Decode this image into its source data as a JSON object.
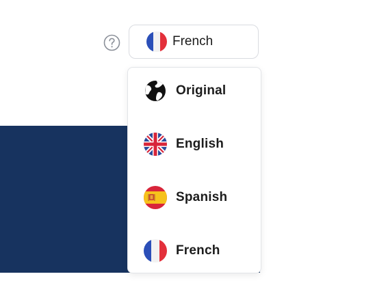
{
  "language_selector": {
    "selected_label": "French",
    "selected_flag": "france-flag-icon",
    "help_icon": "question-circle-icon"
  },
  "dropdown": {
    "options": [
      {
        "label": "Original",
        "icon": "globe-icon"
      },
      {
        "label": "English",
        "icon": "uk-flag-icon"
      },
      {
        "label": "Spanish",
        "icon": "spain-flag-icon"
      },
      {
        "label": "French",
        "icon": "france-flag-icon"
      }
    ]
  },
  "colors": {
    "background_panel": "#17335f",
    "border": "#d9dbe0"
  }
}
